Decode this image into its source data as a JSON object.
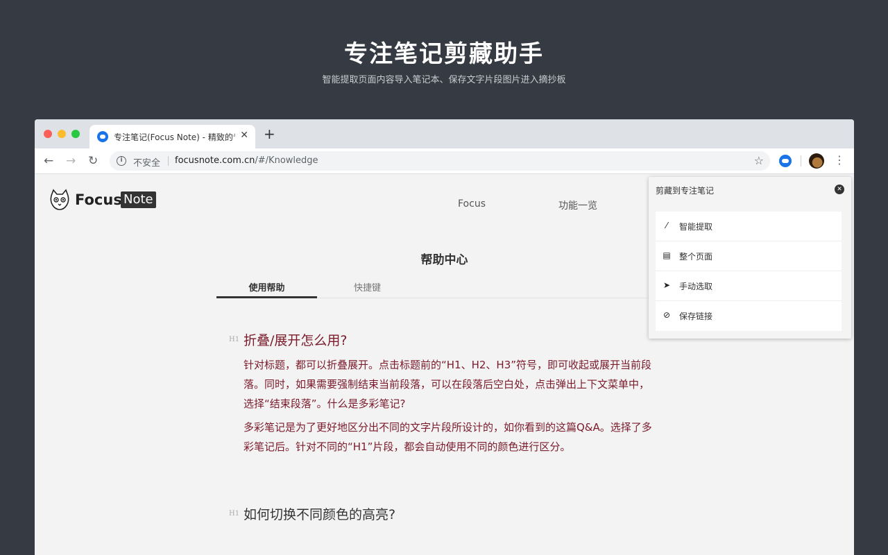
{
  "hero": {
    "title": "专注笔记剪藏助手",
    "subtitle": "智能提取页面内容导入笔记本、保存文字片段图片进入摘抄板"
  },
  "browser": {
    "tab_title": "专注笔记(Focus Note) - 精致的专",
    "tab_close": "✕",
    "new_tab": "+",
    "nav": {
      "back": "←",
      "forward": "→",
      "reload": "↻"
    },
    "security_label": "不安全",
    "url_host": "focusnote.com.cn",
    "url_path": "/#/Knowledge",
    "menu": "⋮",
    "star": "☆"
  },
  "site": {
    "logo_focus": "Focus",
    "logo_note": "Note",
    "nav": {
      "focus": "Focus",
      "features": "功能一览"
    },
    "help_title": "帮助中心",
    "tabs": [
      {
        "label": "使用帮助"
      },
      {
        "label": "快捷键"
      }
    ],
    "sections": [
      {
        "mark": "H1",
        "heading": "折叠/展开怎么用?",
        "paragraphs": [
          "针对标题，都可以折叠展开。点击标题前的“H1、H2、H3”符号，即可收起或展开当前段落。同时，如果需要强制结束当前段落，可以在段落后空白处，点击弹出上下文菜单中，选择“结束段落”。什么是多彩笔记?",
          "多彩笔记是为了更好地区分出不同的文字片段所设计的，如你看到的这篇Q&A。选择了多彩笔记后。针对不同的“H1”片段，都会自动使用不同的颜色进行区分。"
        ]
      },
      {
        "mark": "H1",
        "heading": "如何切换不同颜色的高亮?"
      }
    ]
  },
  "popup": {
    "title": "剪藏到专注笔记",
    "close": "✕",
    "items": [
      {
        "label": "智能提取",
        "icon": "magic-wand-icon",
        "glyph": "⁄"
      },
      {
        "label": "整个页面",
        "icon": "document-icon",
        "glyph": "▤"
      },
      {
        "label": "手动选取",
        "icon": "cursor-icon",
        "glyph": "➤"
      },
      {
        "label": "保存链接",
        "icon": "link-icon",
        "glyph": "⊘"
      }
    ]
  }
}
